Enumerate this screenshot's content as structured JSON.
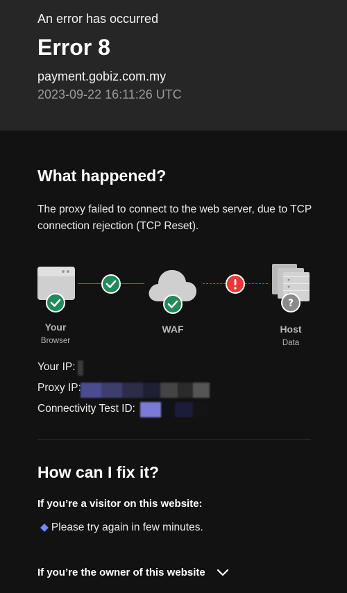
{
  "header": {
    "subtitle": "An error has occurred",
    "error_code": "Error 8",
    "host": "payment.gobiz.com.my",
    "timestamp": "2023-09-22 16:11:26 UTC"
  },
  "what_happened": {
    "title": "What happened?",
    "description": "The proxy failed to connect to the web server, due to TCP connection rejection (TCP Reset)."
  },
  "diagram": {
    "nodes": [
      {
        "label": "Your",
        "sub": "Browser",
        "status": "ok"
      },
      {
        "label": "WAF",
        "sub": "",
        "status": "ok"
      },
      {
        "label": "Host",
        "sub": "Data",
        "status": "unknown"
      }
    ],
    "links": [
      {
        "status": "ok",
        "color": "#2e8b57"
      },
      {
        "status": "error",
        "color": "#e53935"
      }
    ],
    "colors": {
      "ok": "#1f8a5b",
      "error": "#e53935",
      "unknown": "#8a8a8a",
      "node": "#cfcfcf"
    }
  },
  "info": {
    "your_ip_label": "Your IP:",
    "proxy_ip_label": "Proxy IP:",
    "test_id_label": "Connectivity Test ID:"
  },
  "fix": {
    "title": "How can I fix it?",
    "visitor_heading": "If you’re a visitor on this website:",
    "visitor_tip": "Please try again in few minutes.",
    "owner_heading": "If you’re the owner of this website"
  }
}
